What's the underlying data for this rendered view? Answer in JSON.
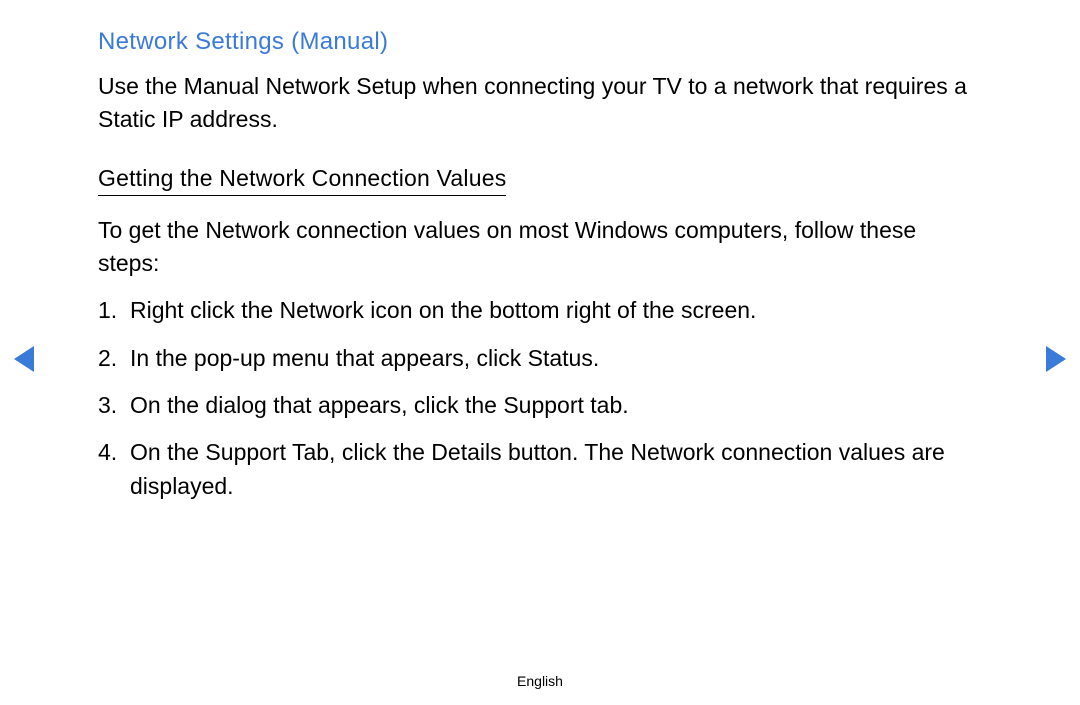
{
  "title": "Network Settings (Manual)",
  "intro": "Use the Manual Network Setup when connecting your TV to a network that requires a Static IP address.",
  "subheading": "Getting the Network Connection Values",
  "steps_intro": "To get the Network connection values on most Windows computers, follow these steps:",
  "steps": [
    "Right click the Network icon on the bottom right of the screen.",
    "In the pop-up menu that appears, click Status.",
    "On the dialog that appears, click the Support tab.",
    "On the Support Tab, click the Details button. The Network connection values are displayed."
  ],
  "footer": "English"
}
